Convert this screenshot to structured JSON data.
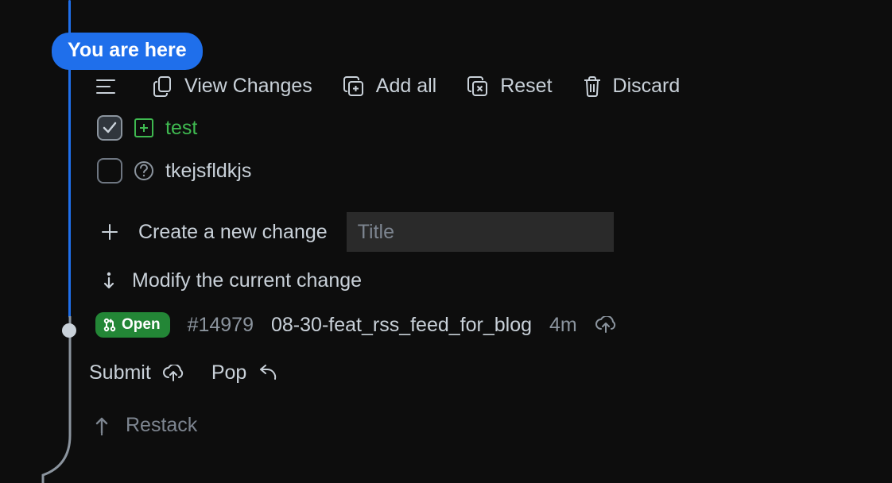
{
  "badge": {
    "label": "You are here"
  },
  "toolbar": {
    "view_changes": "View Changes",
    "add_all": "Add all",
    "reset": "Reset",
    "discard": "Discard"
  },
  "files": [
    {
      "name": "test",
      "status": "added",
      "checked": true
    },
    {
      "name": "tkejsfldkjs",
      "status": "untracked",
      "checked": false
    }
  ],
  "actions": {
    "create": "Create a new change",
    "title_placeholder": "Title",
    "modify": "Modify the current change"
  },
  "pr": {
    "open_label": "Open",
    "number": "#14979",
    "branch": "08-30-feat_rss_feed_for_blog",
    "age": "4m"
  },
  "submit_row": {
    "submit": "Submit",
    "pop": "Pop"
  },
  "restack": {
    "label": "Restack"
  }
}
